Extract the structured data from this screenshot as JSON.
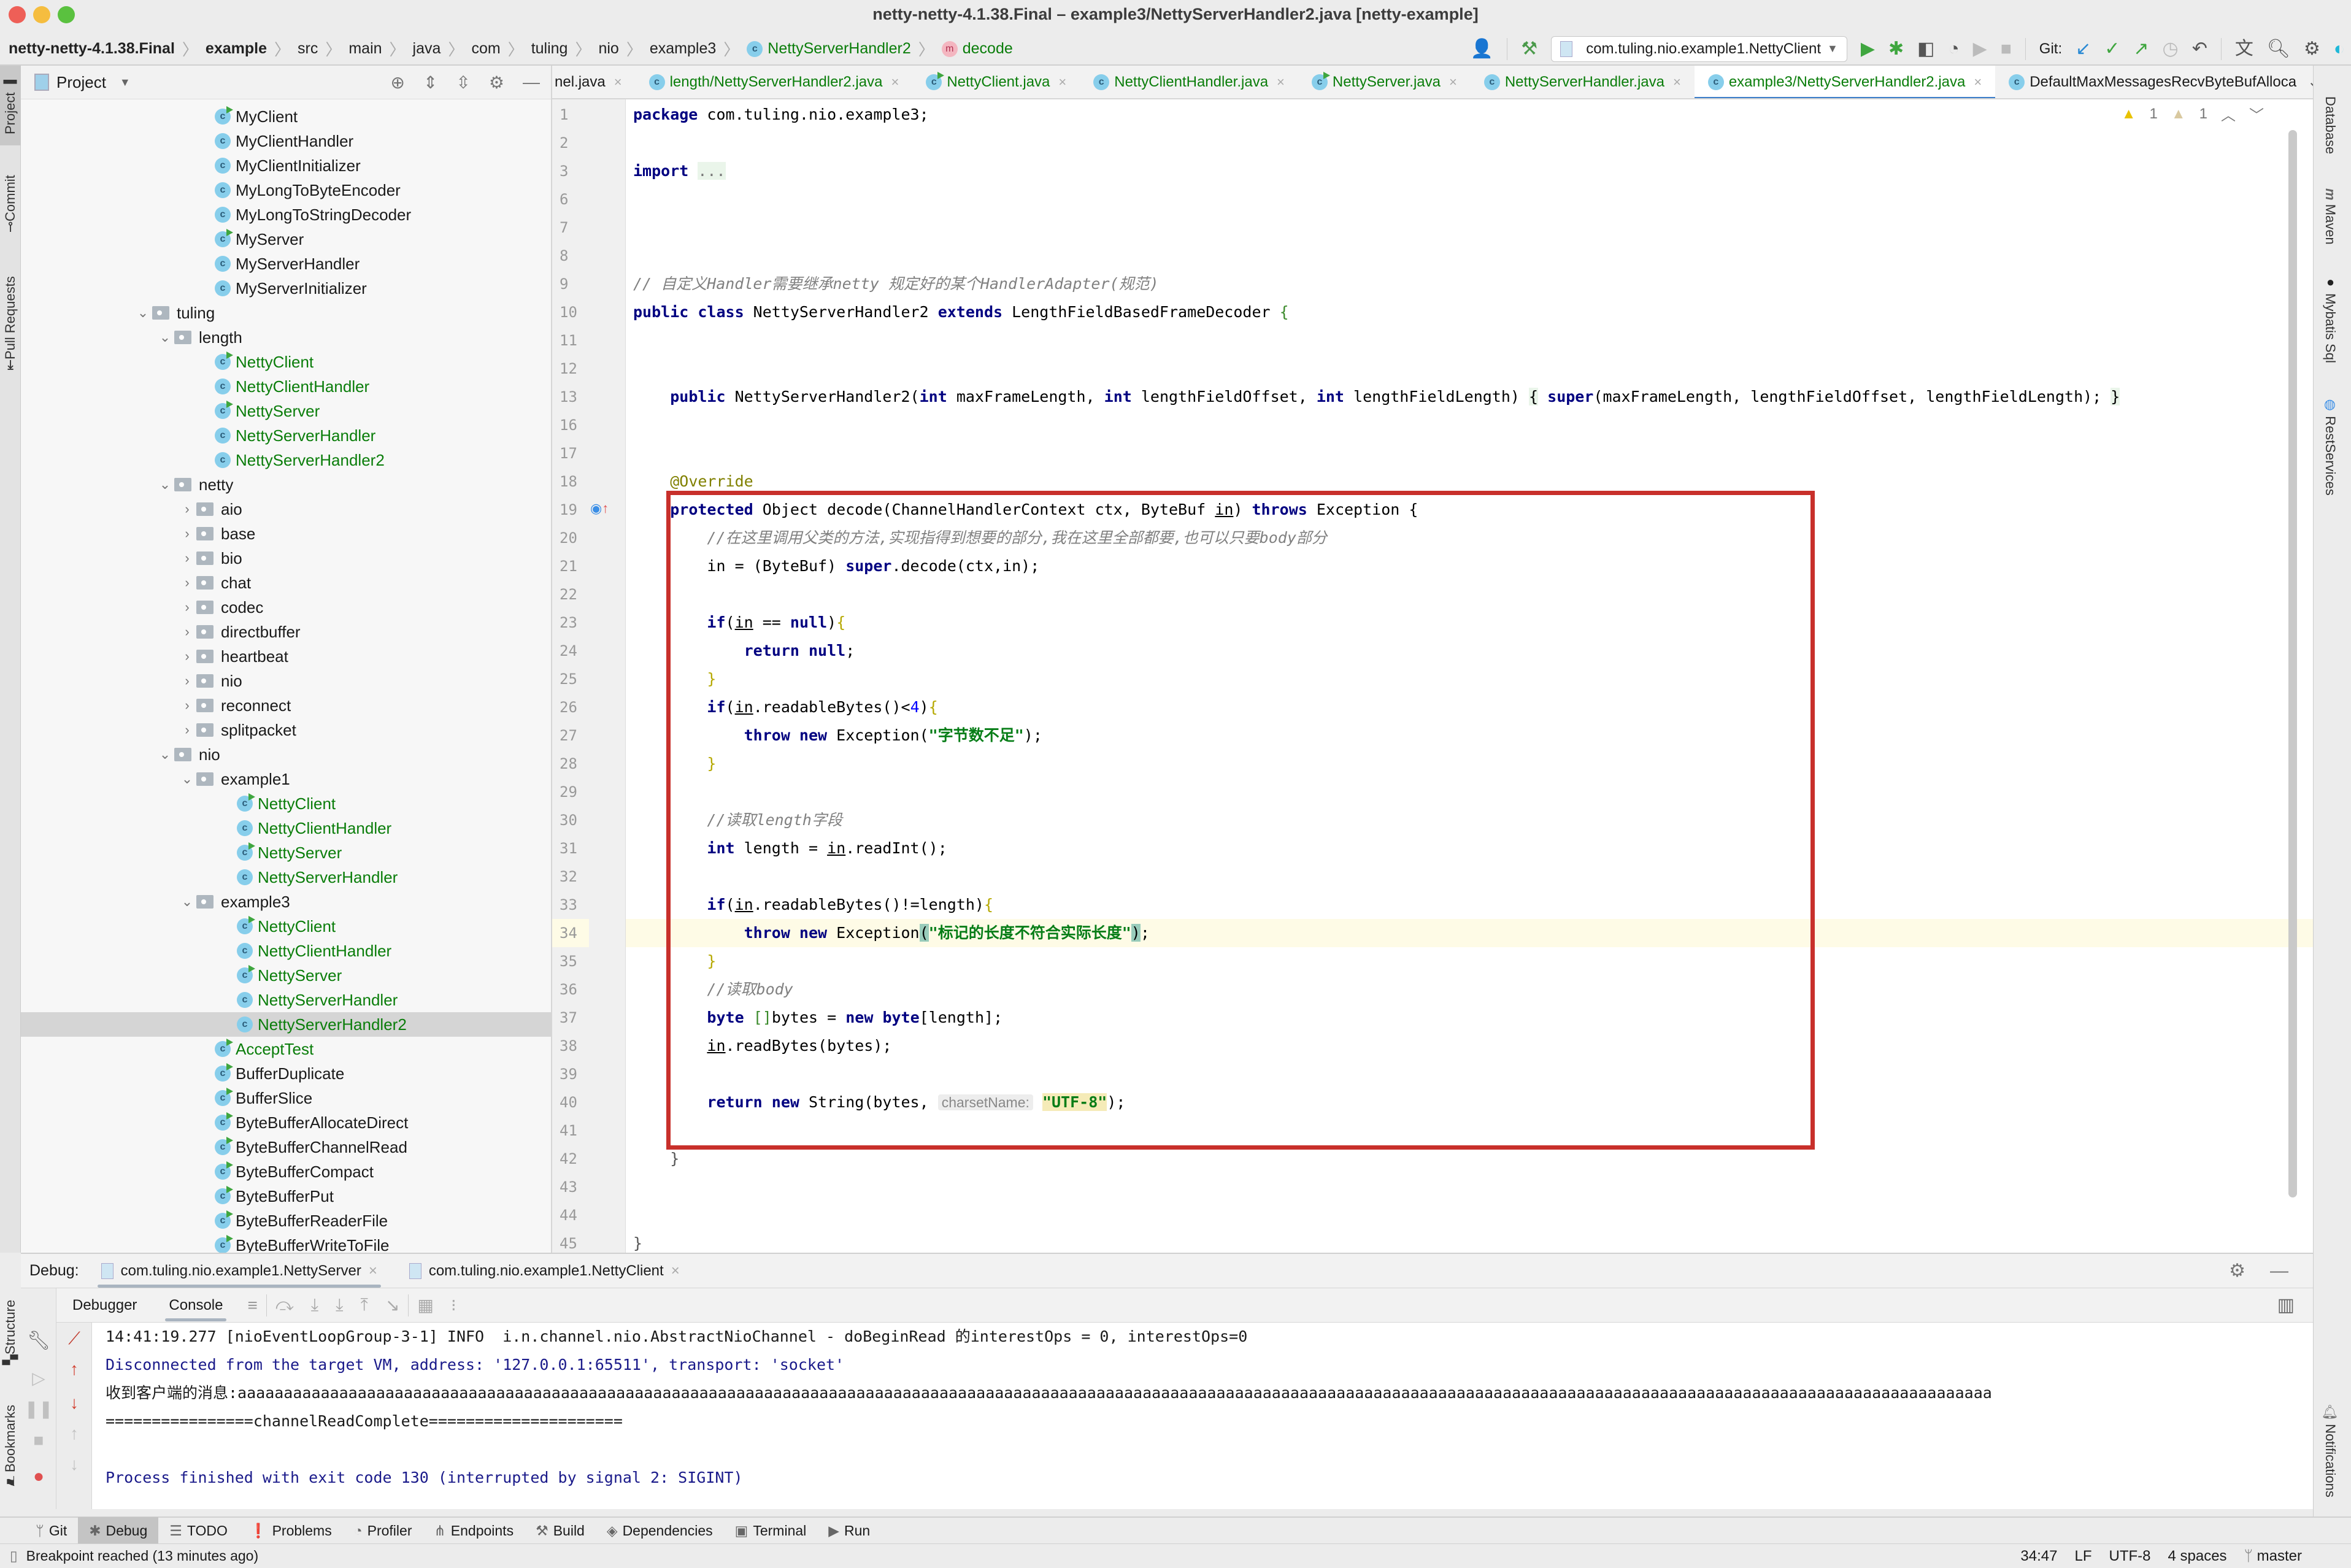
{
  "window": {
    "title": "netty-netty-4.1.38.Final – example3/NettyServerHandler2.java [netty-example]",
    "traffic_lights": [
      "#ee5f57",
      "#f5bd3f",
      "#5ac13f"
    ]
  },
  "breadcrumb": {
    "items": [
      "netty-netty-4.1.38.Final",
      "example",
      "src",
      "main",
      "java",
      "com",
      "tuling",
      "nio",
      "example3",
      "NettyServerHandler2",
      "decode"
    ]
  },
  "toolbar": {
    "run_config": "com.tuling.nio.example1.NettyClient",
    "git_label": "Git:",
    "icons": [
      "user-icon",
      "build-hammer-icon",
      "run-icon",
      "debug-icon",
      "coverage-icon",
      "profile-icon",
      "resume-icon",
      "stop-icon",
      "git-update-icon",
      "git-commit-icon",
      "git-push-icon",
      "history-icon",
      "rollback-icon",
      "translate-icon",
      "search-icon",
      "settings-icon",
      "jetbrains-logo-icon"
    ]
  },
  "left_stripe": {
    "tabs": [
      "Project",
      "Commit",
      "Pull Requests",
      "Structure",
      "Bookmarks"
    ]
  },
  "project_panel": {
    "title": "Project",
    "tree": [
      {
        "label": "MyClient",
        "type": "class-run",
        "level": 3,
        "color": "default"
      },
      {
        "label": "MyClientHandler",
        "type": "class",
        "level": 3,
        "color": "default"
      },
      {
        "label": "MyClientInitializer",
        "type": "class",
        "level": 3,
        "color": "default"
      },
      {
        "label": "MyLongToByteEncoder",
        "type": "class",
        "level": 3,
        "color": "default"
      },
      {
        "label": "MyLongToStringDecoder",
        "type": "class",
        "level": 3,
        "color": "default"
      },
      {
        "label": "MyServer",
        "type": "class-run",
        "level": 3,
        "color": "default"
      },
      {
        "label": "MyServerHandler",
        "type": "class",
        "level": 3,
        "color": "default"
      },
      {
        "label": "MyServerInitializer",
        "type": "class",
        "level": 3,
        "color": "default"
      },
      {
        "label": "tuling",
        "type": "folder-open",
        "level": 1,
        "color": "default"
      },
      {
        "label": "length",
        "type": "folder-open",
        "level": 2,
        "color": "default"
      },
      {
        "label": "NettyClient",
        "type": "class-run",
        "level": 3,
        "color": "green"
      },
      {
        "label": "NettyClientHandler",
        "type": "class",
        "level": 3,
        "color": "green"
      },
      {
        "label": "NettyServer",
        "type": "class-run",
        "level": 3,
        "color": "green"
      },
      {
        "label": "NettyServerHandler",
        "type": "class",
        "level": 3,
        "color": "green"
      },
      {
        "label": "NettyServerHandler2",
        "type": "class",
        "level": 3,
        "color": "green"
      },
      {
        "label": "netty",
        "type": "folder-open",
        "level": 2,
        "color": "default"
      },
      {
        "label": "aio",
        "type": "folder-closed",
        "level": 3,
        "color": "default"
      },
      {
        "label": "base",
        "type": "folder-closed",
        "level": 3,
        "color": "default"
      },
      {
        "label": "bio",
        "type": "folder-closed",
        "level": 3,
        "color": "default"
      },
      {
        "label": "chat",
        "type": "folder-closed",
        "level": 3,
        "color": "default"
      },
      {
        "label": "codec",
        "type": "folder-closed",
        "level": 3,
        "color": "default"
      },
      {
        "label": "directbuffer",
        "type": "folder-closed",
        "level": 3,
        "color": "default"
      },
      {
        "label": "heartbeat",
        "type": "folder-closed",
        "level": 3,
        "color": "default"
      },
      {
        "label": "nio",
        "type": "folder-closed",
        "level": 3,
        "color": "default"
      },
      {
        "label": "reconnect",
        "type": "folder-closed",
        "level": 3,
        "color": "default"
      },
      {
        "label": "splitpacket",
        "type": "folder-closed",
        "level": 3,
        "color": "default"
      },
      {
        "label": "nio",
        "type": "folder-open",
        "level": 2,
        "color": "default"
      },
      {
        "label": "example1",
        "type": "folder-open",
        "level": 3,
        "color": "default"
      },
      {
        "label": "NettyClient",
        "type": "class-run",
        "level": 4,
        "color": "green"
      },
      {
        "label": "NettyClientHandler",
        "type": "class",
        "level": 4,
        "color": "green"
      },
      {
        "label": "NettyServer",
        "type": "class-run",
        "level": 4,
        "color": "green"
      },
      {
        "label": "NettyServerHandler",
        "type": "class",
        "level": 4,
        "color": "green"
      },
      {
        "label": "example3",
        "type": "folder-open",
        "level": 3,
        "color": "default"
      },
      {
        "label": "NettyClient",
        "type": "class-run",
        "level": 4,
        "color": "green"
      },
      {
        "label": "NettyClientHandler",
        "type": "class",
        "level": 4,
        "color": "green"
      },
      {
        "label": "NettyServer",
        "type": "class-run",
        "level": 4,
        "color": "green"
      },
      {
        "label": "NettyServerHandler",
        "type": "class",
        "level": 4,
        "color": "green"
      },
      {
        "label": "NettyServerHandler2",
        "type": "class",
        "level": 4,
        "color": "green",
        "selected": true
      },
      {
        "label": "AcceptTest",
        "type": "class-run",
        "level": 3,
        "color": "green"
      },
      {
        "label": "BufferDuplicate",
        "type": "class-run",
        "level": 3,
        "color": "default"
      },
      {
        "label": "BufferSlice",
        "type": "class-run",
        "level": 3,
        "color": "default"
      },
      {
        "label": "ByteBufferAllocateDirect",
        "type": "class-run",
        "level": 3,
        "color": "default"
      },
      {
        "label": "ByteBufferChannelRead",
        "type": "class-run",
        "level": 3,
        "color": "default"
      },
      {
        "label": "ByteBufferCompact",
        "type": "class-run",
        "level": 3,
        "color": "default"
      },
      {
        "label": "ByteBufferPut",
        "type": "class-run",
        "level": 3,
        "color": "default"
      },
      {
        "label": "ByteBufferReaderFile",
        "type": "class-run",
        "level": 3,
        "color": "default"
      },
      {
        "label": "ByteBufferWriteToFile",
        "type": "class-run",
        "level": 3,
        "color": "default"
      }
    ]
  },
  "editor_tabs": [
    {
      "label": "nel.java",
      "icon": "none",
      "color": "default",
      "active": false
    },
    {
      "label": "length/NettyServerHandler2.java",
      "icon": "class",
      "color": "green",
      "active": false
    },
    {
      "label": "NettyClient.java",
      "icon": "class-run",
      "color": "green",
      "active": false
    },
    {
      "label": "NettyClientHandler.java",
      "icon": "class",
      "color": "green",
      "active": false
    },
    {
      "label": "NettyServer.java",
      "icon": "class-run",
      "color": "green",
      "active": false
    },
    {
      "label": "NettyServerHandler.java",
      "icon": "class",
      "color": "green",
      "active": false
    },
    {
      "label": "example3/NettyServerHandler2.java",
      "icon": "class",
      "color": "green",
      "active": true
    },
    {
      "label": "DefaultMaxMessagesRecvByteBufAlloca",
      "icon": "class",
      "color": "default",
      "active": false
    }
  ],
  "editor": {
    "warnings": {
      "errors_like": "1",
      "weak_warnings": "1"
    },
    "current_line": "34",
    "lines": [
      {
        "n": "1",
        "html": "<span class='kw'>package</span> com.tuling.nio.example3;"
      },
      {
        "n": "2",
        "html": ""
      },
      {
        "n": "3",
        "html": "<span class='kw'>import</span> <span style='background:#eaf5ea;color:#777'>...</span>"
      },
      {
        "n": "6",
        "html": ""
      },
      {
        "n": "7",
        "html": ""
      },
      {
        "n": "8",
        "html": ""
      },
      {
        "n": "9",
        "html": "<span class='cm'>// 自定义Handler需要继承netty 规定好的某个HandlerAdapter(规范)</span>"
      },
      {
        "n": "10",
        "html": "<span class='kw'>public class</span> NettyServerHandler2 <span class='kw'>extends</span> LengthFieldBasedFrameDecoder <span style='color:#3a8a2a'>{</span>"
      },
      {
        "n": "11",
        "html": ""
      },
      {
        "n": "12",
        "html": ""
      },
      {
        "n": "13",
        "html": "    <span class='kw'>public</span> NettyServerHandler2(<span class='kw'>int</span> maxFrameLength, <span class='kw'>int</span> lengthFieldOffset, <span class='kw'>int</span> lengthFieldLength) <span style='background:#eaf5ea'>{</span> <span class='kw'>super</span>(maxFrameLength, lengthFieldOffset, lengthFieldLength); <span style='background:#eaf5ea'>}</span>"
      },
      {
        "n": "16",
        "html": ""
      },
      {
        "n": "17",
        "html": ""
      },
      {
        "n": "18",
        "html": "    <span class='an'>@Override</span>"
      },
      {
        "n": "19",
        "html": "    <span class='kw'>protected</span> Object decode(ChannelHandlerContext ctx, ByteBuf <span class='ul'>in</span>) <span class='kw'>throws</span> Exception {"
      },
      {
        "n": "20",
        "html": "        <span class='cm'>//在这里调用父类的方法,实现指得到想要的部分,我在这里全部都要,也可以只要body部分</span>"
      },
      {
        "n": "21",
        "html": "        in = (ByteBuf) <span class='kw'>super</span>.decode(ctx,in);"
      },
      {
        "n": "22",
        "html": ""
      },
      {
        "n": "23",
        "html": "        <span class='kw'>if</span>(<span class='ul'>in</span> == <span class='kw'>null</span>)<span style='color:#b5a800'>{</span>"
      },
      {
        "n": "24",
        "html": "            <span class='kw'>return null</span>;"
      },
      {
        "n": "25",
        "html": "        <span style='color:#b5a800'>}</span>"
      },
      {
        "n": "26",
        "html": "        <span class='kw'>if</span>(<span class='ul'>in</span>.readableBytes()&lt;<span class='num'>4</span>)<span style='color:#b5a800'>{</span>"
      },
      {
        "n": "27",
        "html": "            <span class='kw'>throw new</span> Exception(<span class='str'>\"字节数不足\"</span>);"
      },
      {
        "n": "28",
        "html": "        <span style='color:#b5a800'>}</span>"
      },
      {
        "n": "29",
        "html": ""
      },
      {
        "n": "30",
        "html": "        <span class='cm'>//读取length字段</span>"
      },
      {
        "n": "31",
        "html": "        <span class='kw'>int</span> length = <span class='ul'>in</span>.readInt();"
      },
      {
        "n": "32",
        "html": ""
      },
      {
        "n": "33",
        "html": "        <span class='kw'>if</span>(<span class='ul'>in</span>.readableBytes()!=length)<span style='color:#b5a800'>{</span>"
      },
      {
        "n": "34",
        "html": "            <span class='kw'>throw new</span> Exception<span style='background:#99ccbb'>(</span><span class='str'>\"标记的长度不符合实际长度\"</span><span style='background:#99ccbb'>)</span>;"
      },
      {
        "n": "35",
        "html": "        <span style='color:#b5a800'>}</span>"
      },
      {
        "n": "36",
        "html": "        <span class='cm'>//读取body</span>"
      },
      {
        "n": "37",
        "html": "        <span class='kw'>byte</span> <span style='color:#3a8a2a'>[]</span>bytes = <span class='kw'>new byte</span>[length];"
      },
      {
        "n": "38",
        "html": "        <span class='ul'>in</span>.readBytes(bytes);"
      },
      {
        "n": "39",
        "html": ""
      },
      {
        "n": "40",
        "html": "        <span class='kw'>return new</span> String(bytes, <span class='hint'>charsetName:</span> <span class='str' style='background:#f5ebb8'>\"UTF-8\"</span>);"
      },
      {
        "n": "41",
        "html": ""
      },
      {
        "n": "42",
        "html": "    <span style='color:#555'>}</span>"
      },
      {
        "n": "43",
        "html": ""
      },
      {
        "n": "44",
        "html": ""
      },
      {
        "n": "45",
        "html": "<span style='color:#555'>}</span>"
      }
    ]
  },
  "right_stripe": {
    "tabs": [
      "Database",
      "Maven",
      "Mybatis Sql",
      "RestServices",
      "Notifications"
    ]
  },
  "debug": {
    "label": "Debug:",
    "sessions": [
      {
        "label": "com.tuling.nio.example1.NettyServer",
        "active": true
      },
      {
        "label": "com.tuling.nio.example1.NettyClient",
        "active": false
      }
    ],
    "subtabs": [
      "Debugger",
      "Console"
    ],
    "active_subtab": "Console",
    "console_lines": [
      {
        "text": "14:41:19.277 [nioEventLoopGroup-3-1] INFO  i.n.channel.nio.AbstractNioChannel - doBeginRead 的interestOps = 0, interestOps=0",
        "kind": "log"
      },
      {
        "text": "Disconnected from the target VM, address: '127.0.0.1:65511', transport: 'socket'",
        "kind": "system"
      },
      {
        "text": "收到客户端的消息:aaaaaaaaaaaaaaaaaaaaaaaaaaaaaaaaaaaaaaaaaaaaaaaaaaaaaaaaaaaaaaaaaaaaaaaaaaaaaaaaaaaaaaaaaaaaaaaaaaaaaaaaaaaaaaaaaaaaaaaaaaaaaaaaaaaaaaaaaaaaaaaaaaaaaaaaaaaaaaaaaaaaaaaaaaaaaaaaaaaaaaaaaaaaaa",
        "kind": "log"
      },
      {
        "text": "================channelReadComplete=====================",
        "kind": "log"
      },
      {
        "text": "",
        "kind": "log"
      },
      {
        "text": "Process finished with exit code 130 (interrupted by signal 2: SIGINT)",
        "kind": "system"
      }
    ]
  },
  "bottom_tools": [
    {
      "label": "Git",
      "icon": "git-branch-icon",
      "active": false
    },
    {
      "label": "Debug",
      "icon": "bug-icon",
      "active": true
    },
    {
      "label": "TODO",
      "icon": "list-icon",
      "active": false
    },
    {
      "label": "Problems",
      "icon": "problems-icon",
      "active": false
    },
    {
      "label": "Profiler",
      "icon": "profiler-icon",
      "active": false
    },
    {
      "label": "Endpoints",
      "icon": "endpoints-icon",
      "active": false
    },
    {
      "label": "Build",
      "icon": "hammer-icon",
      "active": false
    },
    {
      "label": "Dependencies",
      "icon": "dependencies-icon",
      "active": false
    },
    {
      "label": "Terminal",
      "icon": "terminal-icon",
      "active": false
    },
    {
      "label": "Run",
      "icon": "run-icon",
      "active": false
    }
  ],
  "status_bar": {
    "message": "Breakpoint reached (13 minutes ago)",
    "position": "34:47",
    "line_ending": "LF",
    "encoding": "UTF-8",
    "indent": "4 spaces",
    "branch": "master"
  }
}
